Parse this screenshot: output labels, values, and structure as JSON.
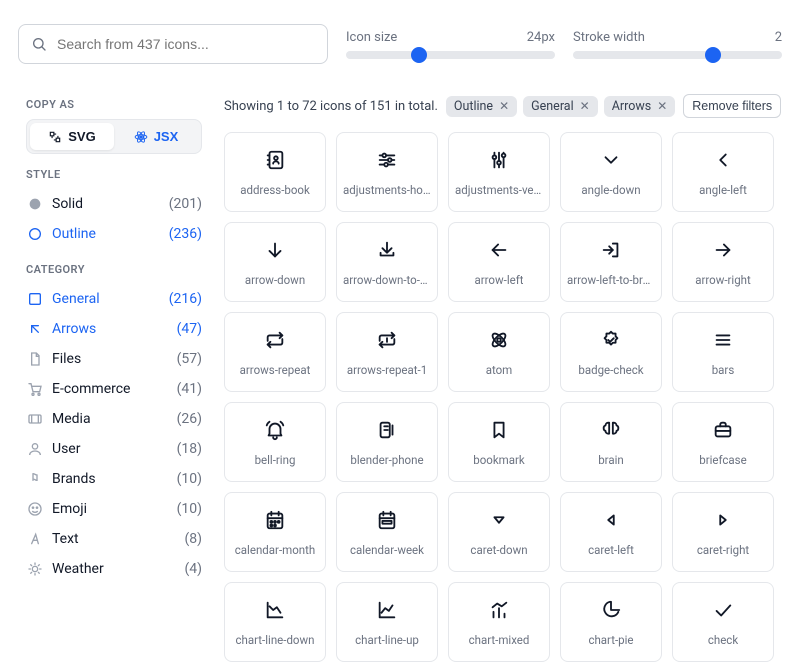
{
  "search": {
    "placeholder": "Search from 437 icons..."
  },
  "sliders": {
    "icon_size": {
      "label": "Icon size",
      "value": "24px",
      "pos": 35
    },
    "stroke_width": {
      "label": "Stroke width",
      "value": "2",
      "pos": 67
    }
  },
  "sidebar": {
    "copy_as_title": "COPY AS",
    "svg_label": "SVG",
    "jsx_label": "JSX",
    "style_title": "STYLE",
    "styles": [
      {
        "label": "Solid",
        "count": "(201)",
        "active": false
      },
      {
        "label": "Outline",
        "count": "(236)",
        "active": true
      }
    ],
    "category_title": "CATEGORY",
    "categories": [
      {
        "label": "General",
        "count": "(216)",
        "active": true
      },
      {
        "label": "Arrows",
        "count": "(47)",
        "active": true
      },
      {
        "label": "Files",
        "count": "(57)",
        "active": false
      },
      {
        "label": "E-commerce",
        "count": "(41)",
        "active": false
      },
      {
        "label": "Media",
        "count": "(26)",
        "active": false
      },
      {
        "label": "User",
        "count": "(18)",
        "active": false
      },
      {
        "label": "Brands",
        "count": "(10)",
        "active": false
      },
      {
        "label": "Emoji",
        "count": "(10)",
        "active": false
      },
      {
        "label": "Text",
        "count": "(8)",
        "active": false
      },
      {
        "label": "Weather",
        "count": "(4)",
        "active": false
      }
    ]
  },
  "content": {
    "summary": "Showing 1 to 72 icons of 151 in total.",
    "chips": [
      "Outline",
      "General",
      "Arrows"
    ],
    "remove_label": "Remove filters",
    "icons": [
      "address-book",
      "adjustments-horizontal",
      "adjustments-vertical",
      "angle-down",
      "angle-left",
      "arrow-down",
      "arrow-down-to-bracket",
      "arrow-left",
      "arrow-left-to-bracket",
      "arrow-right",
      "arrows-repeat",
      "arrows-repeat-1",
      "atom",
      "badge-check",
      "bars",
      "bell-ring",
      "blender-phone",
      "bookmark",
      "brain",
      "briefcase",
      "calendar-month",
      "calendar-week",
      "caret-down",
      "caret-left",
      "caret-right",
      "chart-line-down",
      "chart-line-up",
      "chart-mixed",
      "chart-pie",
      "check"
    ]
  }
}
